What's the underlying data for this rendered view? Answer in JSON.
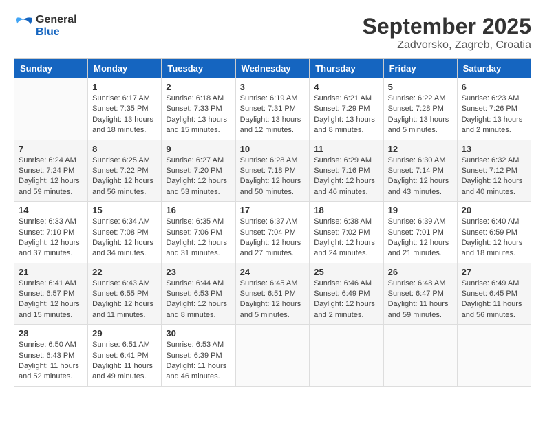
{
  "header": {
    "logo": {
      "general": "General",
      "blue": "Blue"
    },
    "title": "September 2025",
    "location": "Zadvorsko, Zagreb, Croatia"
  },
  "days_of_week": [
    "Sunday",
    "Monday",
    "Tuesday",
    "Wednesday",
    "Thursday",
    "Friday",
    "Saturday"
  ],
  "weeks": [
    [
      {
        "day": "",
        "info": ""
      },
      {
        "day": "1",
        "info": "Sunrise: 6:17 AM\nSunset: 7:35 PM\nDaylight: 13 hours\nand 18 minutes."
      },
      {
        "day": "2",
        "info": "Sunrise: 6:18 AM\nSunset: 7:33 PM\nDaylight: 13 hours\nand 15 minutes."
      },
      {
        "day": "3",
        "info": "Sunrise: 6:19 AM\nSunset: 7:31 PM\nDaylight: 13 hours\nand 12 minutes."
      },
      {
        "day": "4",
        "info": "Sunrise: 6:21 AM\nSunset: 7:29 PM\nDaylight: 13 hours\nand 8 minutes."
      },
      {
        "day": "5",
        "info": "Sunrise: 6:22 AM\nSunset: 7:28 PM\nDaylight: 13 hours\nand 5 minutes."
      },
      {
        "day": "6",
        "info": "Sunrise: 6:23 AM\nSunset: 7:26 PM\nDaylight: 13 hours\nand 2 minutes."
      }
    ],
    [
      {
        "day": "7",
        "info": "Sunrise: 6:24 AM\nSunset: 7:24 PM\nDaylight: 12 hours\nand 59 minutes."
      },
      {
        "day": "8",
        "info": "Sunrise: 6:25 AM\nSunset: 7:22 PM\nDaylight: 12 hours\nand 56 minutes."
      },
      {
        "day": "9",
        "info": "Sunrise: 6:27 AM\nSunset: 7:20 PM\nDaylight: 12 hours\nand 53 minutes."
      },
      {
        "day": "10",
        "info": "Sunrise: 6:28 AM\nSunset: 7:18 PM\nDaylight: 12 hours\nand 50 minutes."
      },
      {
        "day": "11",
        "info": "Sunrise: 6:29 AM\nSunset: 7:16 PM\nDaylight: 12 hours\nand 46 minutes."
      },
      {
        "day": "12",
        "info": "Sunrise: 6:30 AM\nSunset: 7:14 PM\nDaylight: 12 hours\nand 43 minutes."
      },
      {
        "day": "13",
        "info": "Sunrise: 6:32 AM\nSunset: 7:12 PM\nDaylight: 12 hours\nand 40 minutes."
      }
    ],
    [
      {
        "day": "14",
        "info": "Sunrise: 6:33 AM\nSunset: 7:10 PM\nDaylight: 12 hours\nand 37 minutes."
      },
      {
        "day": "15",
        "info": "Sunrise: 6:34 AM\nSunset: 7:08 PM\nDaylight: 12 hours\nand 34 minutes."
      },
      {
        "day": "16",
        "info": "Sunrise: 6:35 AM\nSunset: 7:06 PM\nDaylight: 12 hours\nand 31 minutes."
      },
      {
        "day": "17",
        "info": "Sunrise: 6:37 AM\nSunset: 7:04 PM\nDaylight: 12 hours\nand 27 minutes."
      },
      {
        "day": "18",
        "info": "Sunrise: 6:38 AM\nSunset: 7:02 PM\nDaylight: 12 hours\nand 24 minutes."
      },
      {
        "day": "19",
        "info": "Sunrise: 6:39 AM\nSunset: 7:01 PM\nDaylight: 12 hours\nand 21 minutes."
      },
      {
        "day": "20",
        "info": "Sunrise: 6:40 AM\nSunset: 6:59 PM\nDaylight: 12 hours\nand 18 minutes."
      }
    ],
    [
      {
        "day": "21",
        "info": "Sunrise: 6:41 AM\nSunset: 6:57 PM\nDaylight: 12 hours\nand 15 minutes."
      },
      {
        "day": "22",
        "info": "Sunrise: 6:43 AM\nSunset: 6:55 PM\nDaylight: 12 hours\nand 11 minutes."
      },
      {
        "day": "23",
        "info": "Sunrise: 6:44 AM\nSunset: 6:53 PM\nDaylight: 12 hours\nand 8 minutes."
      },
      {
        "day": "24",
        "info": "Sunrise: 6:45 AM\nSunset: 6:51 PM\nDaylight: 12 hours\nand 5 minutes."
      },
      {
        "day": "25",
        "info": "Sunrise: 6:46 AM\nSunset: 6:49 PM\nDaylight: 12 hours\nand 2 minutes."
      },
      {
        "day": "26",
        "info": "Sunrise: 6:48 AM\nSunset: 6:47 PM\nDaylight: 11 hours\nand 59 minutes."
      },
      {
        "day": "27",
        "info": "Sunrise: 6:49 AM\nSunset: 6:45 PM\nDaylight: 11 hours\nand 56 minutes."
      }
    ],
    [
      {
        "day": "28",
        "info": "Sunrise: 6:50 AM\nSunset: 6:43 PM\nDaylight: 11 hours\nand 52 minutes."
      },
      {
        "day": "29",
        "info": "Sunrise: 6:51 AM\nSunset: 6:41 PM\nDaylight: 11 hours\nand 49 minutes."
      },
      {
        "day": "30",
        "info": "Sunrise: 6:53 AM\nSunset: 6:39 PM\nDaylight: 11 hours\nand 46 minutes."
      },
      {
        "day": "",
        "info": ""
      },
      {
        "day": "",
        "info": ""
      },
      {
        "day": "",
        "info": ""
      },
      {
        "day": "",
        "info": ""
      }
    ]
  ]
}
